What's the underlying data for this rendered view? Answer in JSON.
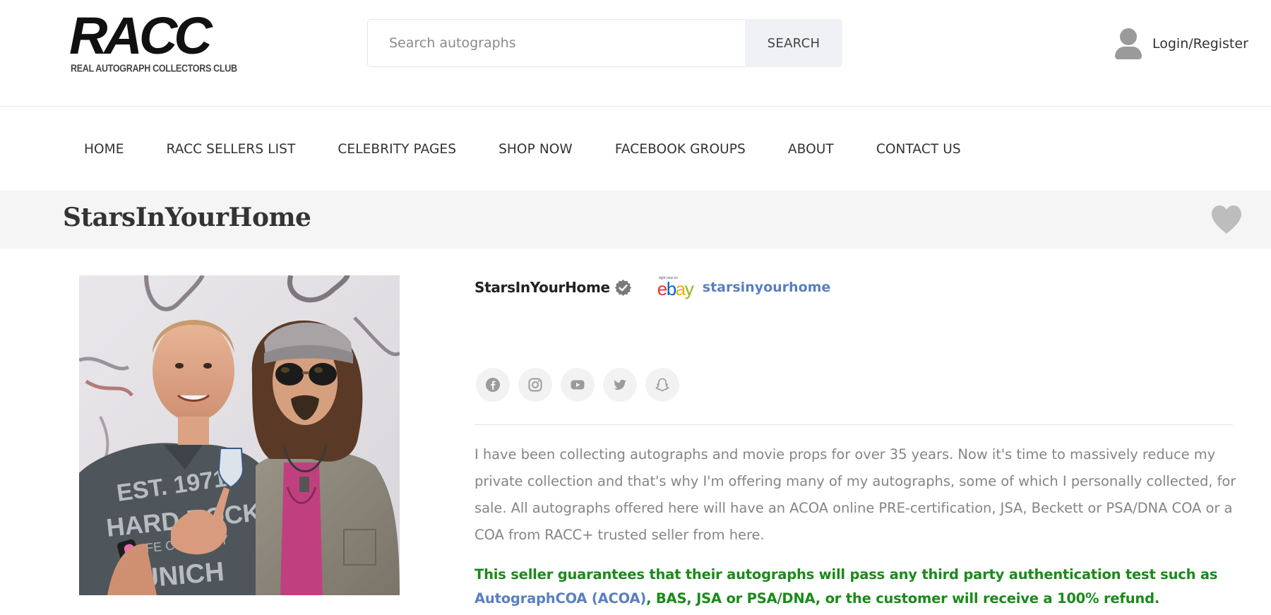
{
  "header": {
    "logo_text": "RACC",
    "logo_subtitle": "REAL AUTOGRAPH COLLECTORS CLUB",
    "search_placeholder": "Search autographs",
    "search_button": "SEARCH",
    "login_label": "Login/Register"
  },
  "nav": {
    "items": [
      {
        "label": "HOME"
      },
      {
        "label": "RACC SELLERS LIST"
      },
      {
        "label": "CELEBRITY PAGES"
      },
      {
        "label": "SHOP NOW"
      },
      {
        "label": "FACEBOOK GROUPS"
      },
      {
        "label": "ABOUT"
      },
      {
        "label": "CONTACT US"
      }
    ]
  },
  "page": {
    "title": "StarsInYourHome"
  },
  "seller": {
    "name": "StarsInYourHome",
    "ebay_tagline": "right now on",
    "ebay_logo_text": "ebay",
    "ebay_username": "starsinyourhome",
    "socials": [
      "facebook-icon",
      "instagram-icon",
      "youtube-icon",
      "twitter-icon",
      "snapchat-icon"
    ],
    "description": "I have been collecting autographs and movie props for over 35 years. Now it's time to massively reduce my private collection and that's why I'm offering many of my autographs, some of which I personally collected, for sale. All autographs offered here will have an ACOA online PRE-certification, JSA, Beckett or PSA/DNA COA or a COA from RACC+ trusted seller from here.",
    "guarantee_part1": "This seller guarantees that their autographs will pass any third party authentication test such as ",
    "guarantee_link": "AutographCOA (ACOA)",
    "guarantee_part2": ", BAS, JSA or PSA/DNA, or the customer will receive a 100% refund."
  },
  "colors": {
    "guarantee_green": "#1a8a1a",
    "link_blue": "#5a7fc0",
    "description_gray": "#858585",
    "title_band_bg": "#f5f5f5"
  }
}
